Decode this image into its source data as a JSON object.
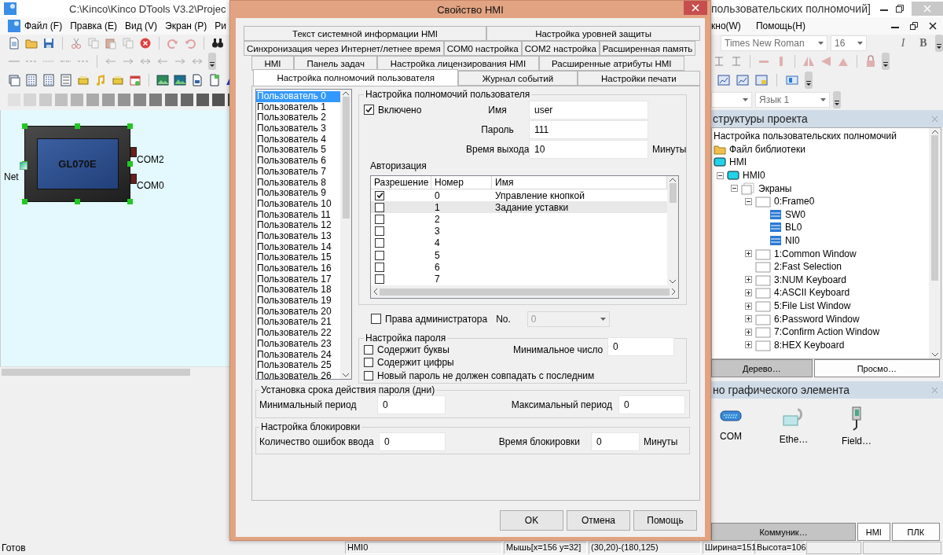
{
  "app": {
    "title_left": "C:\\Kinco\\Kinco DTools V3.2\\Projec",
    "title_right": "пользовательских полномочий]",
    "menu_left": [
      "Файл (F)",
      "Правка (E)",
      "Вид (V)",
      "Экран (P)",
      "Ри"
    ],
    "menu_right": [
      "кно(W)",
      "Помощь(H)"
    ],
    "font_combo": "Times New Roman",
    "size_combo": "16",
    "italic_button": "I",
    "bold_button": "B",
    "language_combo": "Язык 1"
  },
  "canvas": {
    "device_label": "GL070E",
    "ports": [
      "COM2",
      "COM0"
    ],
    "net_label": "Net"
  },
  "project_panel": {
    "title": "структуры проекта",
    "tree": [
      {
        "label": "Настройка пользовательских полномочий",
        "kind": "text"
      },
      {
        "label": "Файл библиотеки",
        "kind": "folder"
      },
      {
        "label": "HMI",
        "kind": "hmi",
        "children": [
          {
            "label": "HMI0",
            "kind": "hmi",
            "expanded": true,
            "children": [
              {
                "label": "Экраны",
                "kind": "group",
                "expanded": true,
                "children": [
                  {
                    "label": "0:Frame0",
                    "kind": "screen",
                    "expanded": true,
                    "children": [
                      {
                        "label": "SW0",
                        "kind": "element"
                      },
                      {
                        "label": "BL0",
                        "kind": "element"
                      },
                      {
                        "label": "NI0",
                        "kind": "element"
                      }
                    ]
                  },
                  {
                    "label": "1:Common Window",
                    "kind": "screen",
                    "expanded": false
                  },
                  {
                    "label": "2:Fast Selection",
                    "kind": "screen"
                  },
                  {
                    "label": "3:NUM Keyboard",
                    "kind": "screen",
                    "expanded": false
                  },
                  {
                    "label": "4:ASCII Keyboard",
                    "kind": "screen",
                    "expanded": false
                  },
                  {
                    "label": "5:File List Window",
                    "kind": "screen",
                    "expanded": false
                  },
                  {
                    "label": "6:Password Window",
                    "kind": "screen",
                    "expanded": false
                  },
                  {
                    "label": "7:Confirm Action Window",
                    "kind": "screen",
                    "expanded": false
                  },
                  {
                    "label": "8:HEX Keyboard",
                    "kind": "screen",
                    "expanded": false
                  }
                ]
              }
            ]
          }
        ]
      }
    ],
    "tabs": [
      {
        "label": "Дерево…",
        "selected": true
      },
      {
        "label": "Просмо…",
        "selected": false
      }
    ]
  },
  "element_panel": {
    "title": "но графического элемента",
    "items": [
      {
        "label": "COM",
        "kind": "serial"
      },
      {
        "label": "Ethe…",
        "kind": "ethernet"
      },
      {
        "label": "Field…",
        "kind": "fieldbus"
      }
    ],
    "tabs": [
      {
        "label": "Коммуник…",
        "selected": true
      },
      {
        "label": "HMI",
        "selected": false
      },
      {
        "label": "ПЛК",
        "selected": false
      }
    ]
  },
  "status_bar": {
    "message": "Готов",
    "cells": [
      "HMI0",
      "Мышь[x=156  y=32]",
      "(30,20)-(180,125)",
      "Ширина=151",
      "Высота=106"
    ]
  },
  "dialog": {
    "title": "Свойство HMI",
    "tab_rows": [
      [
        {
          "label": "Текст системной информации HMI",
          "selected": false
        },
        {
          "label": "Настройка уровней защиты",
          "selected": false
        }
      ],
      [
        {
          "label": "Синхронизация через Интернет/летнее время",
          "selected": false
        },
        {
          "label": "COM0 настройка",
          "selected": false
        },
        {
          "label": "COM2 настройка",
          "selected": false
        },
        {
          "label": "Расширенная память",
          "selected": false
        }
      ],
      [
        {
          "label": "HMI",
          "selected": false
        },
        {
          "label": "Панель задач",
          "selected": false
        },
        {
          "label": "Настройка лицензирования HMI",
          "selected": false
        },
        {
          "label": "Расширенные атрибуты HMI",
          "selected": false
        }
      ],
      [
        {
          "label": "Настройка полномочий пользователя",
          "selected": true
        },
        {
          "label": "Журнал событий",
          "selected": false
        },
        {
          "label": "Настройки печати",
          "selected": false
        }
      ]
    ],
    "users": [
      {
        "label": "Пользователь 0",
        "selected": true
      },
      {
        "label": "Пользователь 1",
        "selected": false
      },
      {
        "label": "Пользователь 2",
        "selected": false
      },
      {
        "label": "Пользователь 3",
        "selected": false
      },
      {
        "label": "Пользователь 4",
        "selected": false
      },
      {
        "label": "Пользователь 5",
        "selected": false
      },
      {
        "label": "Пользователь 6",
        "selected": false
      },
      {
        "label": "Пользователь 7",
        "selected": false
      },
      {
        "label": "Пользователь 8",
        "selected": false
      },
      {
        "label": "Пользователь 9",
        "selected": false
      },
      {
        "label": "Пользователь 10",
        "selected": false
      },
      {
        "label": "Пользователь 11",
        "selected": false
      },
      {
        "label": "Пользователь 12",
        "selected": false
      },
      {
        "label": "Пользователь 13",
        "selected": false
      },
      {
        "label": "Пользователь 14",
        "selected": false
      },
      {
        "label": "Пользователь 15",
        "selected": false
      },
      {
        "label": "Пользователь 16",
        "selected": false
      },
      {
        "label": "Пользователь 17",
        "selected": false
      },
      {
        "label": "Пользователь 18",
        "selected": false
      },
      {
        "label": "Пользователь 19",
        "selected": false
      },
      {
        "label": "Пользователь 20",
        "selected": false
      },
      {
        "label": "Пользователь 21",
        "selected": false
      },
      {
        "label": "Пользователь 22",
        "selected": false
      },
      {
        "label": "Пользователь 23",
        "selected": false
      },
      {
        "label": "Пользователь 24",
        "selected": false
      },
      {
        "label": "Пользователь 25",
        "selected": false
      },
      {
        "label": "Пользователь 26",
        "selected": false
      }
    ],
    "permissions": {
      "title": "Настройка полномочий пользователя",
      "enabled": {
        "label": "Включено",
        "checked": true
      },
      "fields": [
        {
          "label": "Имя",
          "value": "user"
        },
        {
          "label": "Пароль",
          "value": "111"
        },
        {
          "label": "Время выхода",
          "value": "10",
          "unit": "Минуты"
        }
      ],
      "authorization_label": "Авторизация",
      "columns": [
        "Разрешение",
        "Номер",
        "Имя"
      ],
      "rows": [
        {
          "checked": true,
          "number": "0",
          "name": "Управление кнопкой",
          "selected": false
        },
        {
          "checked": false,
          "number": "1",
          "name": "Задание уставки",
          "selected": true
        },
        {
          "checked": false,
          "number": "2",
          "selected": false
        },
        {
          "checked": false,
          "number": "3",
          "selected": false
        },
        {
          "checked": false,
          "number": "4",
          "selected": false
        },
        {
          "checked": false,
          "number": "5",
          "selected": false
        },
        {
          "checked": false,
          "number": "6",
          "selected": false
        },
        {
          "checked": false,
          "number": "7",
          "selected": false
        }
      ]
    },
    "admin": {
      "label": "Права администратора",
      "checked": false,
      "no_label": "No.",
      "no_value": "0",
      "disabled": true
    },
    "password": {
      "title": "Настройка пароля",
      "options": [
        {
          "label": "Содержит буквы",
          "checked": false
        },
        {
          "label": "Содержит цифры",
          "checked": false
        },
        {
          "label": "Новый пароль не должен совпадать с последним",
          "checked": false
        }
      ],
      "min_label": "Минимальное число",
      "min_value": "0"
    },
    "expiry": {
      "title": "Установка срока действия пароля (дни)",
      "min_label": "Минимальный период",
      "min_value": "0",
      "max_label": "Максимальный период",
      "max_value": "0"
    },
    "lockout": {
      "title": "Настройка блокировки",
      "errors_label": "Количество ошибок ввода",
      "errors_value": "0",
      "time_label": "Время блокировки",
      "time_value": "0",
      "unit": "Минуты"
    },
    "buttons": [
      "OK",
      "Отмена",
      "Помощь"
    ]
  }
}
